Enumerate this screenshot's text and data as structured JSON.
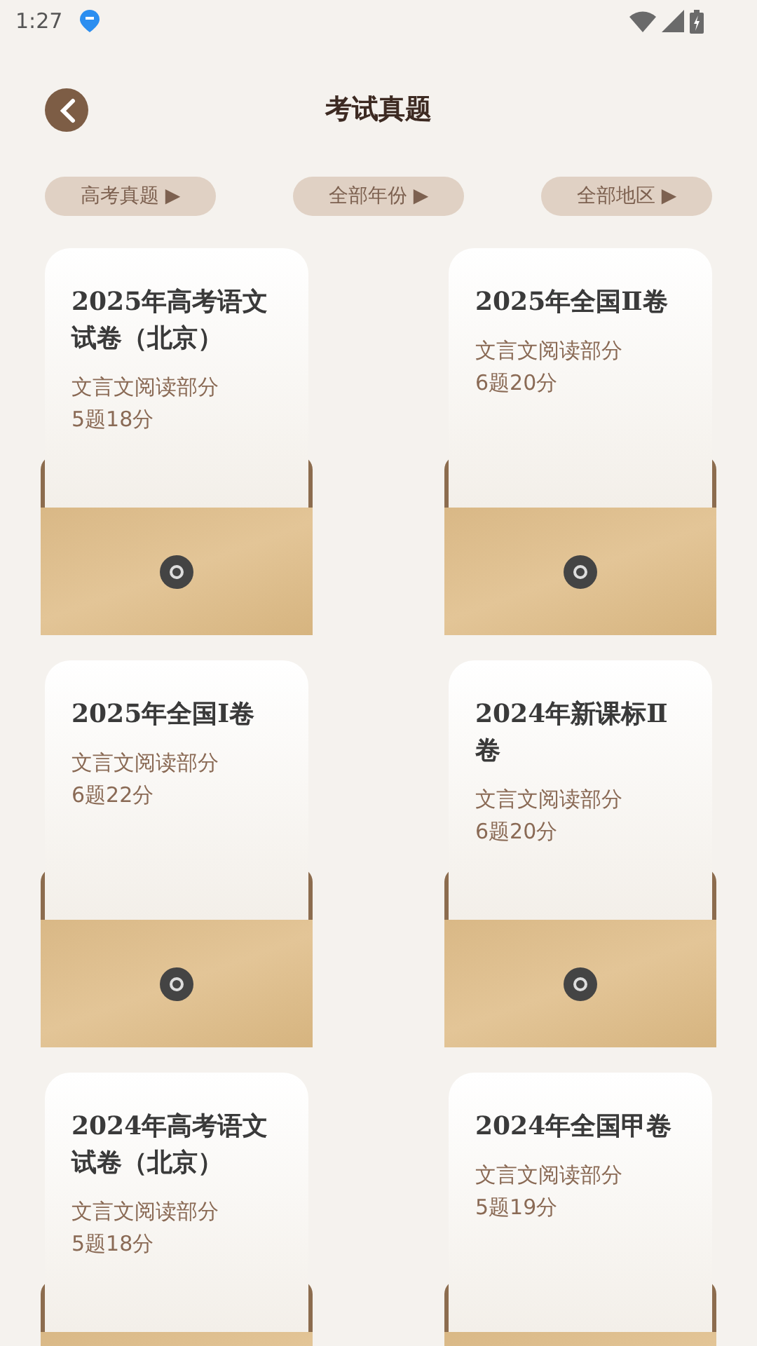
{
  "status_bar": {
    "time": "1:27"
  },
  "header": {
    "title": "考试真题"
  },
  "filters": [
    {
      "label": "高考真题",
      "arrow": "▶"
    },
    {
      "label": "全部年份",
      "arrow": "▶"
    },
    {
      "label": "全部地区",
      "arrow": "▶"
    }
  ],
  "papers": [
    {
      "title": "2025年高考语文试卷（北京）",
      "subtitle": "文言文阅读部分",
      "detail": "5题18分"
    },
    {
      "title": "2025年全国Ⅱ卷",
      "subtitle": "文言文阅读部分",
      "detail": "6题20分"
    },
    {
      "title": "2025年全国Ⅰ卷",
      "subtitle": "文言文阅读部分",
      "detail": "6题22分"
    },
    {
      "title": "2024年新课标Ⅱ卷",
      "subtitle": "文言文阅读部分",
      "detail": "6题20分"
    },
    {
      "title": "2024年高考语文试卷（北京）",
      "subtitle": "文言文阅读部分",
      "detail": "5题18分"
    },
    {
      "title": "2024年全国甲卷",
      "subtitle": "文言文阅读部分",
      "detail": "5题19分"
    }
  ]
}
